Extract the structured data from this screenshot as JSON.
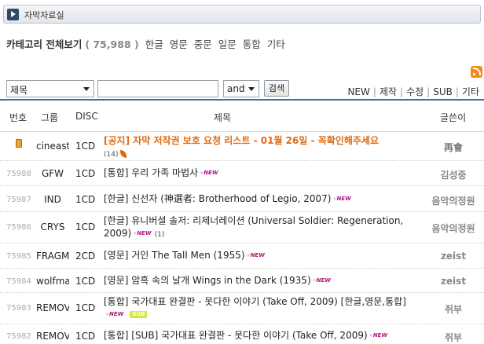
{
  "header": {
    "title": "자막자료실"
  },
  "category": {
    "label": "카테고리 전체보기",
    "count": "( 75,988 )",
    "links": [
      "한글",
      "영문",
      "중문",
      "일문",
      "통합",
      "기타"
    ]
  },
  "search": {
    "field_value": "제목",
    "query_value": "",
    "op_value": "and",
    "button_label": "검색"
  },
  "top_links": [
    "NEW",
    "제작",
    "수정",
    "SUB",
    "기타"
  ],
  "columns": {
    "num": "번호",
    "group": "그룹",
    "disc": "DISC",
    "title": "제목",
    "writer": "글쓴이"
  },
  "rows": [
    {
      "num": "",
      "group": "cineast",
      "disc": "1CD",
      "title": "[공지] 자막 저작권 보호 요청 리스트 - 01월 26일 - 꼭확인해주세요",
      "comments": "(14)",
      "writer": "再會",
      "is_new": false,
      "notice": true
    },
    {
      "num": "75988",
      "group": "GFW",
      "disc": "1CD",
      "title": "[통합] 우리 가족 마법사",
      "comments": "",
      "writer": "김성중",
      "is_new": true
    },
    {
      "num": "75987",
      "group": "IND",
      "disc": "1CD",
      "title": "[한글] 신선자 (神選者: Brotherhood of Legio, 2007)",
      "comments": "",
      "writer": "음악의정원",
      "is_new": true
    },
    {
      "num": "75986",
      "group": "CRYS",
      "disc": "1CD",
      "title": "[한글] 유니버셜 솔저: 리제너레이션 (Universal Soldier: Regeneration, 2009)",
      "comments": "(1)",
      "writer": "음악의정원",
      "is_new": true
    },
    {
      "num": "75985",
      "group": "FRAGMI",
      "disc": "2CD",
      "title": "[영문] 거인 The Tall Men (1955)",
      "comments": "",
      "writer": "zeist",
      "is_new": true
    },
    {
      "num": "75984",
      "group": "wolfma",
      "disc": "1CD",
      "title": "[영문] 암흑 속의 날개 Wings in the Dark (1935)",
      "comments": "",
      "writer": "zeist",
      "is_new": true
    },
    {
      "num": "75983",
      "group": "REMOV",
      "disc": "1CD",
      "title": "[통합] 국가대표 완결판 - 못다한 이야기 (Take Off, 2009) [한글,영문,통합]",
      "comments": "",
      "writer": "쥐부",
      "is_new": true,
      "badge": "SUB"
    },
    {
      "num": "75982",
      "group": "REMOV",
      "disc": "1CD",
      "title": "[통합] [SUB] 국가대표 완결판 - 못다한 이야기 (Take Off, 2009)",
      "comments": "",
      "writer": "쥐부",
      "is_new": true
    }
  ],
  "new_icon_text": "NEW",
  "colors": {
    "accent": "#3d6f9e",
    "notice": "#e06a10",
    "new": "#b2147a",
    "sub_badge": "#d6e641"
  }
}
